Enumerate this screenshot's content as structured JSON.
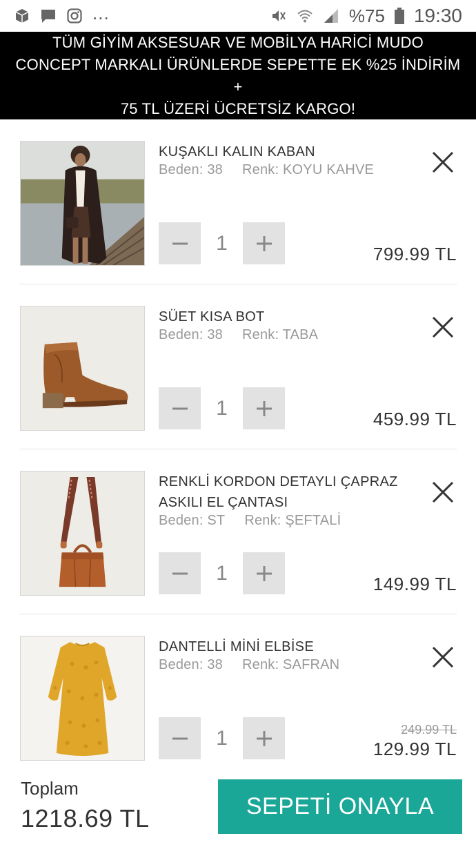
{
  "status_bar": {
    "battery_text": "%75",
    "time": "19:30",
    "overflow": "..."
  },
  "banner": {
    "text_line1": "TÜM GİYİM AKSESUAR VE MOBİLYA HARİCİ MUDO",
    "text_line2": "CONCEPT MARKALI ÜRÜNLERDE SEPETTE EK %25 İNDİRİM +",
    "text_line3": "75 TL ÜZERİ ÜCRETSİZ KARGO!"
  },
  "cart": {
    "items": [
      {
        "name": "KUŞAKLI KALIN KABAN",
        "size_label": "Beden: 38",
        "color_label": "Renk: KOYU KAHVE",
        "quantity": "1",
        "price": "799.99 TL"
      },
      {
        "name": "SÜET KISA BOT",
        "size_label": "Beden: 38",
        "color_label": "Renk: TABA",
        "quantity": "1",
        "price": "459.99 TL"
      },
      {
        "name": "RENKLİ KORDON DETAYLI ÇAPRAZ ASKILI EL ÇANTASI",
        "size_label": "Beden: ST",
        "color_label": "Renk: ŞEFTALİ",
        "quantity": "1",
        "price": "149.99 TL"
      },
      {
        "name": "DANTELLİ MİNİ ELBİSE",
        "size_label": "Beden: 38",
        "color_label": "Renk: SAFRAN",
        "quantity": "1",
        "old_price": "249.99 TL",
        "price": "129.99 TL"
      }
    ]
  },
  "footer": {
    "total_label": "Toplam",
    "total_value": "1218.69 TL",
    "confirm_label": "SEPETİ ONAYLA"
  },
  "icons": {
    "remove": "close-icon",
    "decrease": "minus-icon",
    "increase": "plus-icon"
  },
  "colors": {
    "banner_bg": "#000000",
    "confirm_button": "#1ba798",
    "qty_button_bg": "#e2e2e2"
  }
}
